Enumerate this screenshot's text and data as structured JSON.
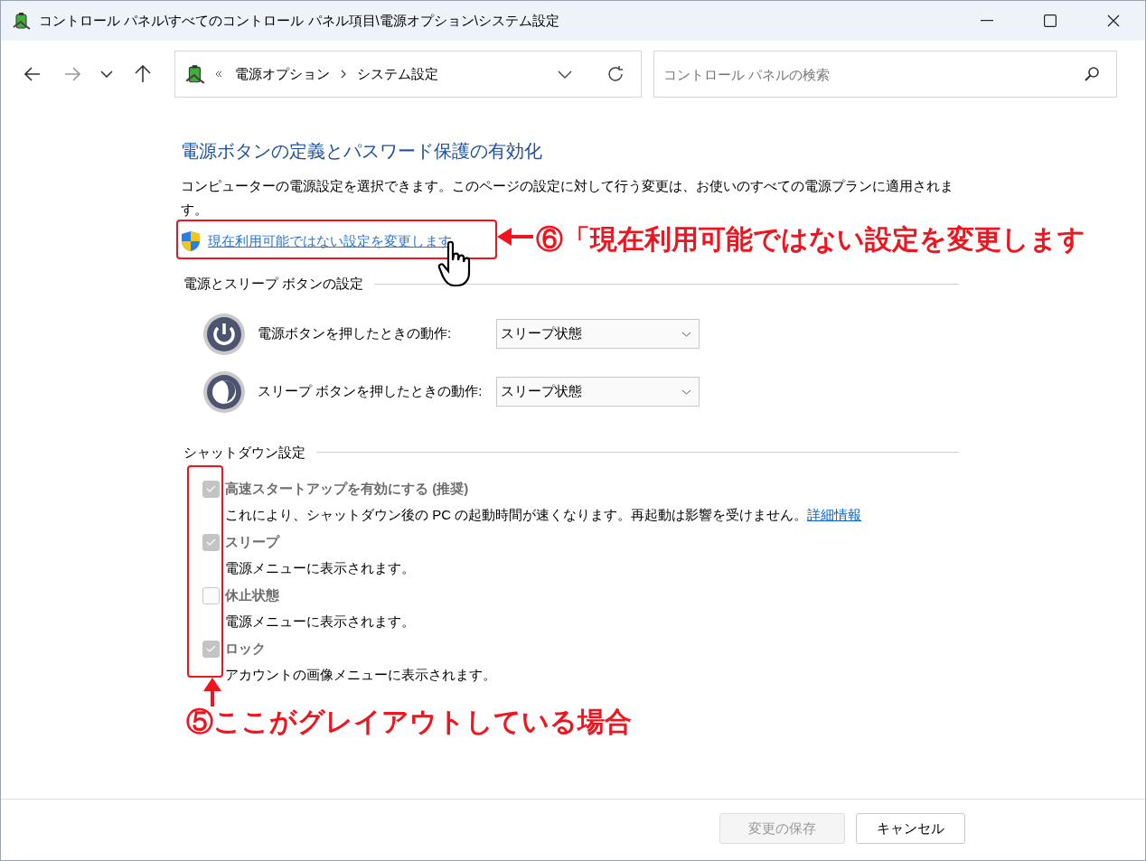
{
  "window": {
    "title": "コントロール パネル\\すべてのコントロール パネル項目\\電源オプション\\システム設定"
  },
  "address_bar": {
    "breadcrumb": [
      "電源オプション",
      "システム設定"
    ]
  },
  "search": {
    "placeholder": "コントロール パネルの検索"
  },
  "heading": "電源ボタンの定義とパスワード保護の有効化",
  "description": "コンピューターの電源設定を選択できます。このページの設定に対して行う変更は、お使いのすべての電源プランに適用されます。",
  "change_link": "現在利用可能ではない設定を変更します",
  "power_section": {
    "title": "電源とスリープ ボタンの設定",
    "rows": [
      {
        "kind": "power",
        "label": "電源ボタンを押したときの動作:",
        "value": "スリープ状態"
      },
      {
        "kind": "sleep",
        "label": "スリープ ボタンを押したときの動作:",
        "value": "スリープ状態"
      }
    ]
  },
  "shutdown_section": {
    "title": "シャットダウン設定",
    "items": [
      {
        "label": "高速スタートアップを有効にする (推奨)",
        "checked": true,
        "disabled": true,
        "description": "これにより、シャットダウン後の PC の起動時間が速くなります。再起動は影響を受けません。",
        "link": "詳細情報"
      },
      {
        "label": "スリープ",
        "checked": true,
        "disabled": true,
        "description": "電源メニューに表示されます。"
      },
      {
        "label": "休止状態",
        "checked": false,
        "disabled": true,
        "description": "電源メニューに表示されます。"
      },
      {
        "label": "ロック",
        "checked": true,
        "disabled": true,
        "description": "アカウントの画像メニューに表示されます。"
      }
    ]
  },
  "buttons": [
    {
      "label": "変更の保存",
      "disabled": true
    },
    {
      "label": "キャンセル",
      "disabled": false
    }
  ],
  "annotations": [
    {
      "kind": "link_callout",
      "text": "⑥「現在利用可能ではない設定を変更します"
    },
    {
      "kind": "checkbox_callout",
      "text": "⑤ここがグレイアウトしている場合"
    }
  ]
}
